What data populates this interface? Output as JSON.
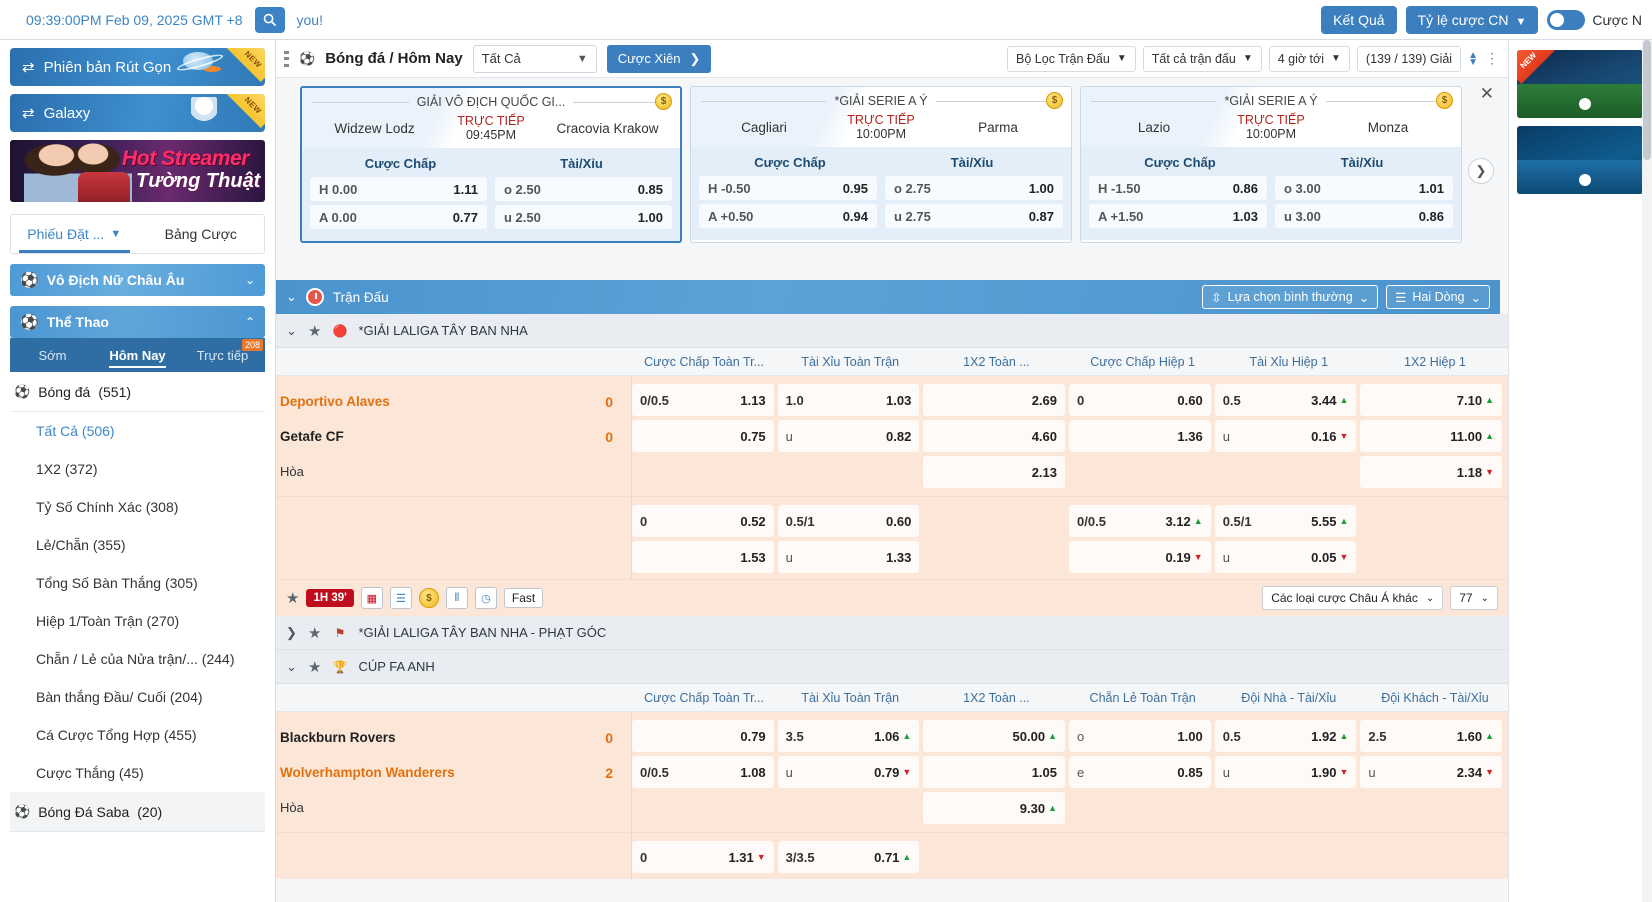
{
  "topbar": {
    "clock": "09:39:00PM Feb 09, 2025 GMT +8",
    "search_icon": "search-icon",
    "greeting": "you!",
    "results_label": "Kết Quả",
    "odds_type_label": "Tỷ lệ cược CN",
    "toggle_label": "Cược N"
  },
  "sidebar": {
    "promos": [
      {
        "label": "Phiên bản Rút Gọn",
        "flag": "NEW"
      },
      {
        "label": "Galaxy",
        "flag": "NEW"
      }
    ],
    "banner": {
      "line1": "Hot Streamer",
      "line2": "Tường Thuật"
    },
    "bet_tabs": [
      {
        "label": "Phiếu Đặt ...",
        "active": true
      },
      {
        "label": "Bảng Cược",
        "active": false
      }
    ],
    "section_euro": "Vô Địch Nữ Châu Âu",
    "section_sports": "Thể Thao",
    "sport_tabs": [
      {
        "label": "Sớm",
        "badge": ""
      },
      {
        "label": "Hôm Nay",
        "badge": ""
      },
      {
        "label": "Trực tiếp",
        "badge": "208"
      }
    ],
    "sport_header": {
      "label": "Bóng đá",
      "count": "(551)"
    },
    "markets": [
      {
        "label": "Tất Cả",
        "count": "(506)",
        "active": true
      },
      {
        "label": "1X2",
        "count": "(372)",
        "active": false
      },
      {
        "label": "Tỷ Số Chính Xác",
        "count": "(308)",
        "active": false
      },
      {
        "label": "Lẻ/Chẵn",
        "count": "(355)",
        "active": false
      },
      {
        "label": "Tổng Số Bàn Thắng",
        "count": "(305)",
        "active": false
      },
      {
        "label": "Hiệp 1/Toàn Trận",
        "count": "(270)",
        "active": false
      },
      {
        "label": "Chẵn / Lẻ của Nửa trận/...",
        "count": "(244)",
        "active": false
      },
      {
        "label": "Bàn thắng Đầu/ Cuối",
        "count": "(204)",
        "active": false
      },
      {
        "label": "Cá Cược Tổng Hợp",
        "count": "(455)",
        "active": false
      },
      {
        "label": "Cược Thắng",
        "count": "(45)",
        "active": false
      }
    ],
    "sport_footer": {
      "label": "Bóng Đá Saba",
      "count": "(20)"
    }
  },
  "toolbar": {
    "breadcrumb": "Bóng đá / Hôm Nay",
    "filter_select": "Tất Cả",
    "parlay_label": "Cược Xiên",
    "chips": [
      {
        "label": "Bộ Lọc Trận Đấu",
        "caret": true
      },
      {
        "label": "Tất cả trận đấu",
        "caret": true
      },
      {
        "label": "4 giờ tới",
        "caret": true
      },
      {
        "label": "(139 / 139) Giải",
        "caret": false
      }
    ]
  },
  "cards": [
    {
      "league": "GIẢI VÔ ĐỊCH QUỐC GI...",
      "home": "Widzew Lodz",
      "away": "Cracovia Krakow",
      "live_label": "TRỰC TIẾP",
      "time": "09:45PM",
      "markets": [
        "Cược Chấp",
        "Tài/Xỉu"
      ],
      "rows": [
        {
          "hdcp_label": "H 0.00",
          "hdcp_odd": "1.11",
          "ou_label": "o 2.50",
          "ou_odd": "0.85"
        },
        {
          "hdcp_label": "A 0.00",
          "hdcp_odd": "0.77",
          "ou_label": "u 2.50",
          "ou_odd": "1.00"
        }
      ],
      "selected": true
    },
    {
      "league": "*GIẢI SERIE A Ý",
      "home": "Cagliari",
      "away": "Parma",
      "live_label": "TRỰC TIẾP",
      "time": "10:00PM",
      "markets": [
        "Cược Chấp",
        "Tài/Xỉu"
      ],
      "rows": [
        {
          "hdcp_label": "H -0.50",
          "hdcp_odd": "0.95",
          "ou_label": "o 2.75",
          "ou_odd": "1.00"
        },
        {
          "hdcp_label": "A +0.50",
          "hdcp_odd": "0.94",
          "ou_label": "u 2.75",
          "ou_odd": "0.87"
        }
      ],
      "selected": false
    },
    {
      "league": "*GIẢI SERIE A Ý",
      "home": "Lazio",
      "away": "Monza",
      "live_label": "TRỰC TIẾP",
      "time": "10:00PM",
      "markets": [
        "Cược Chấp",
        "Tài/Xỉu"
      ],
      "rows": [
        {
          "hdcp_label": "H -1.50",
          "hdcp_odd": "0.86",
          "ou_label": "o 3.00",
          "ou_odd": "1.01"
        },
        {
          "hdcp_label": "A +1.50",
          "hdcp_odd": "1.03",
          "ou_label": "u 3.00",
          "ou_odd": "0.86"
        }
      ],
      "selected": false
    }
  ],
  "bluebar": {
    "title": "Trận Đấu",
    "view_mode": "Lựa chọn bình thường",
    "rows_mode": "Hai Dòng"
  },
  "leagues": [
    {
      "name": "*GIẢI LALIGA TÂY BAN NHA",
      "expanded": true,
      "badge_icon": "laliga-icon",
      "columns": [
        "Cược Chấp Toàn Tr...",
        "Tài Xỉu Toàn Trận",
        "1X2 Toàn ...",
        "Cược Chấp Hiệp 1",
        "Tài Xỉu Hiệp 1",
        "1X2 Hiệp 1"
      ],
      "matches": [
        {
          "home": "Deportivo Alaves",
          "away": "Getafe CF",
          "draw_label": "Hòa",
          "home_score": "0",
          "away_score": "0",
          "block1": [
            [
              {
                "lbl": "0/0.5",
                "val": "1.13",
                "arrow": ""
              },
              {
                "lbl": "1.0",
                "val": "1.03",
                "arrow": ""
              },
              {
                "lbl": "",
                "val": "2.69",
                "arrow": ""
              },
              {
                "lbl": "0",
                "val": "0.60",
                "arrow": ""
              },
              {
                "lbl": "0.5",
                "val": "3.44",
                "arrow": "up"
              },
              {
                "lbl": "",
                "val": "7.10",
                "arrow": "up"
              }
            ],
            [
              {
                "lbl": "",
                "val": "0.75",
                "arrow": ""
              },
              {
                "lbl": "u",
                "val": "0.82",
                "arrow": ""
              },
              {
                "lbl": "",
                "val": "4.60",
                "arrow": ""
              },
              {
                "lbl": "",
                "val": "1.36",
                "arrow": ""
              },
              {
                "lbl": "u",
                "val": "0.16",
                "arrow": "down"
              },
              {
                "lbl": "",
                "val": "11.00",
                "arrow": "up"
              }
            ],
            [
              {
                "lbl": "",
                "val": "",
                "arrow": ""
              },
              {
                "lbl": "",
                "val": "",
                "arrow": ""
              },
              {
                "lbl": "",
                "val": "2.13",
                "arrow": ""
              },
              {
                "lbl": "",
                "val": "",
                "arrow": ""
              },
              {
                "lbl": "",
                "val": "",
                "arrow": ""
              },
              {
                "lbl": "",
                "val": "1.18",
                "arrow": "down"
              }
            ]
          ],
          "block2": [
            [
              {
                "lbl": "0",
                "val": "0.52",
                "arrow": ""
              },
              {
                "lbl": "0.5/1",
                "val": "0.60",
                "arrow": ""
              },
              {
                "lbl": "",
                "val": "",
                "arrow": ""
              },
              {
                "lbl": "0/0.5",
                "val": "3.12",
                "arrow": "up"
              },
              {
                "lbl": "0.5/1",
                "val": "5.55",
                "arrow": "up"
              },
              {
                "lbl": "",
                "val": "",
                "arrow": ""
              }
            ],
            [
              {
                "lbl": "",
                "val": "1.53",
                "arrow": ""
              },
              {
                "lbl": "u",
                "val": "1.33",
                "arrow": ""
              },
              {
                "lbl": "",
                "val": "",
                "arrow": ""
              },
              {
                "lbl": "",
                "val": "0.19",
                "arrow": "down"
              },
              {
                "lbl": "u",
                "val": "0.05",
                "arrow": "down"
              },
              {
                "lbl": "",
                "val": "",
                "arrow": ""
              }
            ]
          ],
          "fastbar": {
            "live_time": "1H 39'",
            "icons": [
              "pitch-icon",
              "list-icon",
              "coin-icon",
              "stats-icon",
              "history-icon"
            ],
            "fast_label": "Fast",
            "market_select": "Các loại cược Châu Á khác",
            "count_select": "77"
          }
        }
      ]
    },
    {
      "name": "*GIẢI LALIGA TÂY BAN NHA - PHẠT GÓC",
      "expanded": false,
      "badge_icon": "corner-flag-icon",
      "columns": [],
      "matches": []
    },
    {
      "name": "CÚP FA ANH",
      "expanded": true,
      "badge_icon": "facup-icon",
      "columns": [
        "Cược Chấp Toàn Tr...",
        "Tài Xỉu Toàn Trận",
        "1X2 Toàn ...",
        "Chẵn Lẻ Toàn Trận",
        "Đội Nhà - Tài/Xỉu",
        "Đội Khách - Tài/Xỉu"
      ],
      "matches": [
        {
          "home": "Blackburn Rovers",
          "away": "Wolverhampton Wanderers",
          "draw_label": "Hòa",
          "home_score": "0",
          "away_score": "2",
          "block1": [
            [
              {
                "lbl": "",
                "val": "0.79",
                "arrow": ""
              },
              {
                "lbl": "3.5",
                "val": "1.06",
                "arrow": "up"
              },
              {
                "lbl": "",
                "val": "50.00",
                "arrow": "up"
              },
              {
                "lbl": "o",
                "val": "1.00",
                "arrow": ""
              },
              {
                "lbl": "0.5",
                "val": "1.92",
                "arrow": "up"
              },
              {
                "lbl": "2.5",
                "val": "1.60",
                "arrow": "up"
              }
            ],
            [
              {
                "lbl": "0/0.5",
                "val": "1.08",
                "arrow": ""
              },
              {
                "lbl": "u",
                "val": "0.79",
                "arrow": "down"
              },
              {
                "lbl": "",
                "val": "1.05",
                "arrow": ""
              },
              {
                "lbl": "e",
                "val": "0.85",
                "arrow": ""
              },
              {
                "lbl": "u",
                "val": "1.90",
                "arrow": "down"
              },
              {
                "lbl": "u",
                "val": "2.34",
                "arrow": "down"
              }
            ],
            [
              {
                "lbl": "",
                "val": "",
                "arrow": ""
              },
              {
                "lbl": "",
                "val": "",
                "arrow": ""
              },
              {
                "lbl": "",
                "val": "9.30",
                "arrow": "up"
              },
              {
                "lbl": "",
                "val": "",
                "arrow": ""
              },
              {
                "lbl": "",
                "val": "",
                "arrow": ""
              },
              {
                "lbl": "",
                "val": "",
                "arrow": ""
              }
            ]
          ],
          "block2": [
            [
              {
                "lbl": "0",
                "val": "1.31",
                "arrow": "down"
              },
              {
                "lbl": "3/3.5",
                "val": "0.71",
                "arrow": "up"
              },
              {
                "lbl": "",
                "val": "",
                "arrow": ""
              },
              {
                "lbl": "",
                "val": "",
                "arrow": ""
              },
              {
                "lbl": "",
                "val": "",
                "arrow": ""
              },
              {
                "lbl": "",
                "val": "",
                "arrow": ""
              }
            ]
          ],
          "fastbar": null
        }
      ]
    }
  ],
  "rail": {
    "new_flag": "NEW"
  }
}
